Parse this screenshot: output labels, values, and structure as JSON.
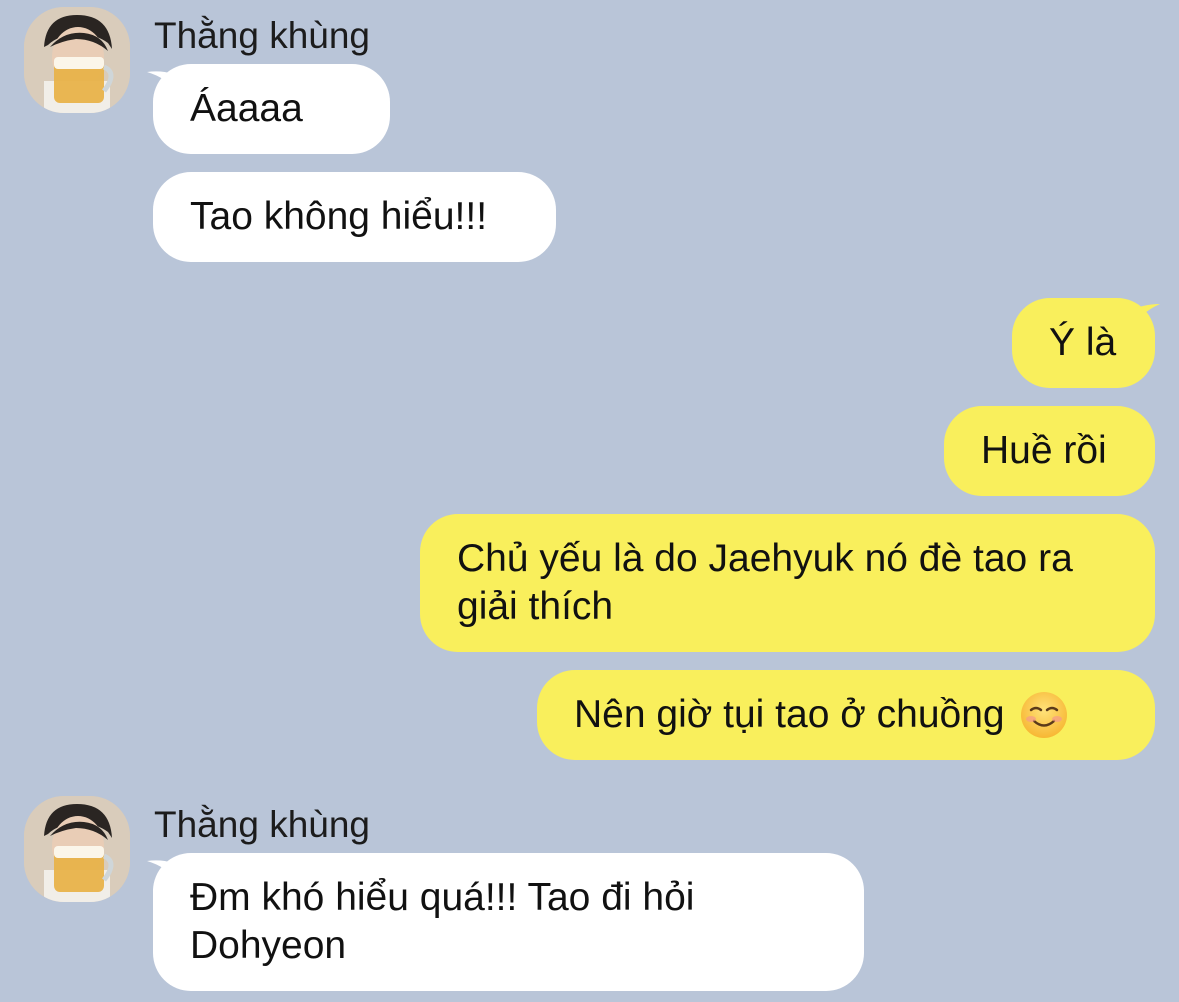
{
  "colors": {
    "background": "#b9c5d8",
    "incoming_bubble": "#ffffff",
    "outgoing_bubble": "#f9ef5c"
  },
  "messages": [
    {
      "sender": "Thằng khùng",
      "side": "in",
      "text": "Áaaaa",
      "avatar": "avatar-photo"
    },
    {
      "side": "in",
      "text": "Tao không hiểu!!!"
    },
    {
      "side": "out",
      "text": "Ý là"
    },
    {
      "side": "out",
      "text": "Huề rồi"
    },
    {
      "side": "out",
      "text": "Chủ yếu là do Jaehyuk nó đè tao ra giải thích"
    },
    {
      "side": "out",
      "text": "Nên giờ tụi tao ở chuồng",
      "emoji": "smiling-face-icon"
    },
    {
      "sender": "Thằng khùng",
      "side": "in",
      "text": "Đm khó hiểu quá!!! Tao đi hỏi Dohyeon",
      "avatar": "avatar-photo"
    }
  ]
}
